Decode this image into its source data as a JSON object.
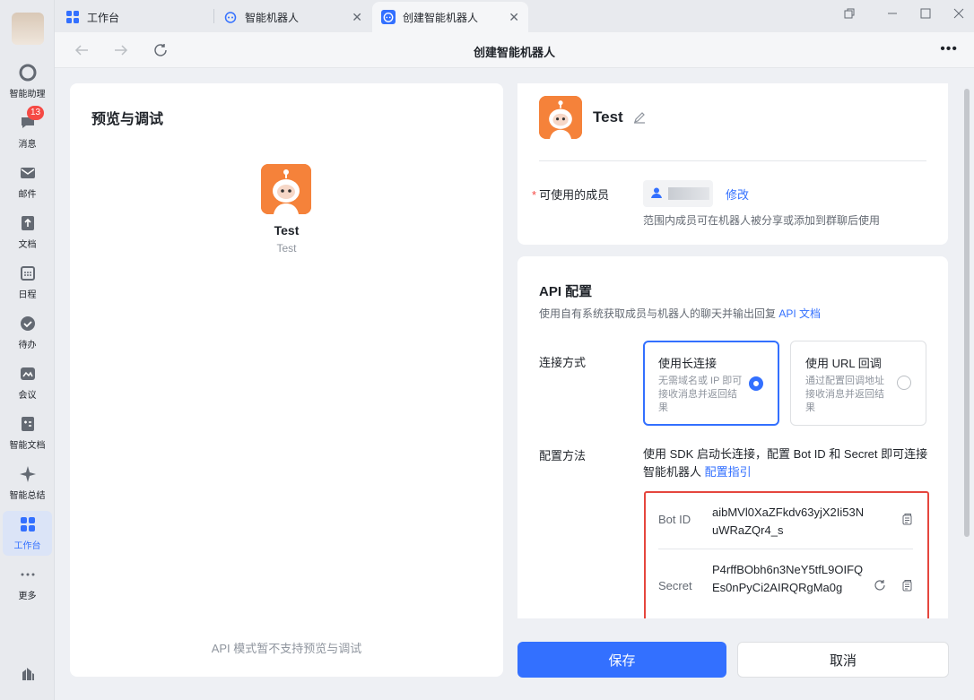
{
  "rail": {
    "items": [
      {
        "label": "智能助理"
      },
      {
        "label": "消息",
        "badge": "13"
      },
      {
        "label": "邮件"
      },
      {
        "label": "文档"
      },
      {
        "label": "日程"
      },
      {
        "label": "待办"
      },
      {
        "label": "会议"
      },
      {
        "label": "智能文档"
      },
      {
        "label": "智能总结"
      },
      {
        "label": "工作台"
      },
      {
        "label": "更多"
      }
    ],
    "active": "工作台"
  },
  "tabs": [
    {
      "label": "工作台",
      "icon": "grid-icon"
    },
    {
      "label": "智能机器人",
      "icon": "bot-icon"
    },
    {
      "label": "创建智能机器人",
      "icon": "bot-icon",
      "active": true
    }
  ],
  "navbar": {
    "title": "创建智能机器人"
  },
  "preview": {
    "title": "预览与调试",
    "bot_name": "Test",
    "bot_desc": "Test",
    "note": "API 模式暂不支持预览与调试"
  },
  "bot": {
    "name": "Test",
    "members_label": "可使用的成员",
    "required_mark": "*",
    "modify_label": "修改",
    "members_hint": "范围内成员可在机器人被分享或添加到群聊后使用"
  },
  "api": {
    "title": "API 配置",
    "subtitle": "使用自有系统获取成员与机器人的聊天并输出回复",
    "doc_link": "API 文档",
    "connect_label": "连接方式",
    "options": [
      {
        "title": "使用长连接",
        "desc": "无需域名或 IP 即可接收消息并返回结果",
        "selected": true
      },
      {
        "title": "使用 URL 回调",
        "desc": "通过配置回调地址接收消息并返回结果",
        "selected": false
      }
    ],
    "method_label": "配置方法",
    "method_text": "使用 SDK 启动长连接，配置 Bot ID 和 Secret 即可连接智能机器人",
    "method_link": "配置指引",
    "bot_id_label": "Bot ID",
    "bot_id_value": "aibMVl0XaZFkdv63yjX2Ii53NuWRaZQr4_s",
    "secret_label": "Secret",
    "secret_value": "P4rffBObh6n3NeY5tfL9OIFQEs0nPyCi2AIRQRgMa0g"
  },
  "actions": {
    "save": "保存",
    "cancel": "取消"
  },
  "colors": {
    "accent": "#3370ff",
    "highlight_border": "#e5463e",
    "bot_avatar": "#f5823a"
  }
}
